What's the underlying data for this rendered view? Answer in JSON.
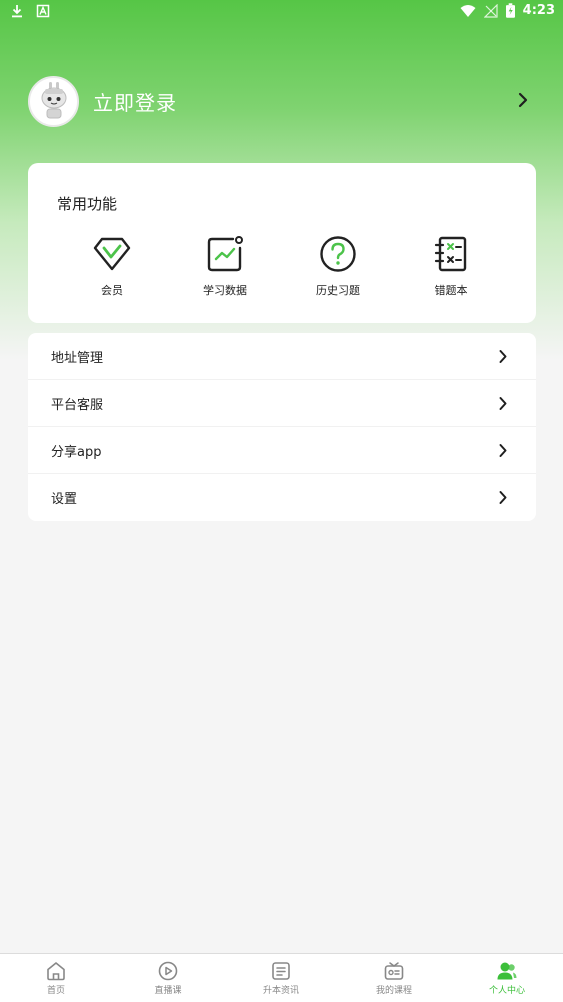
{
  "status_bar": {
    "time": "4:23"
  },
  "profile": {
    "login_label": "立即登录"
  },
  "common_functions": {
    "title": "常用功能",
    "items": [
      {
        "label": "会员",
        "icon": "diamond-icon"
      },
      {
        "label": "学习数据",
        "icon": "chart-icon"
      },
      {
        "label": "历史习题",
        "icon": "question-icon"
      },
      {
        "label": "错题本",
        "icon": "notebook-icon"
      }
    ]
  },
  "menu": {
    "items": [
      {
        "label": "地址管理"
      },
      {
        "label": "平台客服"
      },
      {
        "label": "分享app"
      },
      {
        "label": "设置"
      }
    ]
  },
  "tabbar": {
    "items": [
      {
        "label": "首页",
        "icon": "home-icon"
      },
      {
        "label": "直播课",
        "icon": "play-icon"
      },
      {
        "label": "升本资讯",
        "icon": "news-icon"
      },
      {
        "label": "我的课程",
        "icon": "course-icon"
      },
      {
        "label": "个人中心",
        "icon": "user-icon"
      }
    ],
    "active": "个人中心"
  },
  "colors": {
    "accent": "#3cbf3a",
    "header_green": "#56c646"
  }
}
